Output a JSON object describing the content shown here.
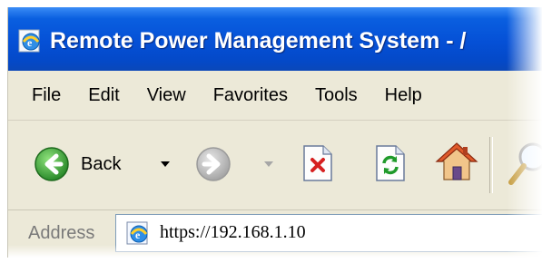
{
  "window": {
    "title": "Remote Power Management System - /",
    "title_icon": "ie-page-icon"
  },
  "menu": [
    "File",
    "Edit",
    "View",
    "Favorites",
    "Tools",
    "Help"
  ],
  "toolbar": {
    "back_label": "Back",
    "icons": [
      "back-arrow-icon",
      "forward-arrow-icon",
      "stop-icon",
      "refresh-icon",
      "home-icon",
      "search-icon"
    ]
  },
  "address": {
    "label": "Address",
    "url": "https://192.168.1.10"
  },
  "colors": {
    "titlebar": "#0550d6",
    "chrome": "#ece9d8",
    "back_green": "#3aa03a",
    "forward_gray": "#b8b8b8",
    "stop_red": "#d62020",
    "refresh_green": "#1f9a2a"
  }
}
